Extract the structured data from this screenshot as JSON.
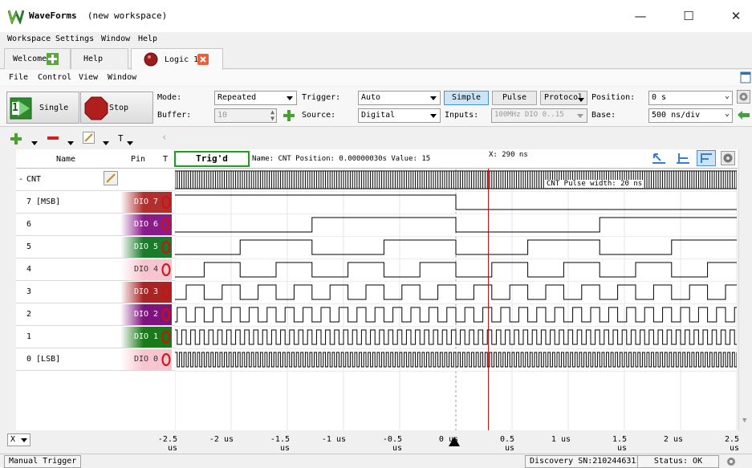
{
  "window": {
    "app_name": "WaveForms",
    "workspace": "(new workspace)",
    "controls": {
      "minimize": "—",
      "maximize": "☐",
      "close": "✕"
    }
  },
  "menubar": [
    "Workspace",
    "Settings",
    "Window",
    "Help"
  ],
  "tabs": [
    {
      "label": "Welcome"
    },
    {
      "label": "Help"
    },
    {
      "label": "Logic 1"
    }
  ],
  "submenu": [
    "File",
    "Control",
    "View",
    "Window"
  ],
  "toolbar": {
    "single_label": "Single",
    "single_badge": "1",
    "stop_label": "Stop",
    "mode_label": "Mode:",
    "mode_value": "Repeated",
    "buffer_label": "Buffer:",
    "buffer_value": "10",
    "trigger_label": "Trigger:",
    "trigger_value": "Auto",
    "source_label": "Source:",
    "source_value": "Digital",
    "simple_label": "Simple",
    "pulse_label": "Pulse",
    "protocol_label": "Protocol",
    "inputs_label": "Inputs:",
    "inputs_value": "100MHz DIO 0..15",
    "position_label": "Position:",
    "position_value": "0 s",
    "base_label": "Base:",
    "base_value": "500 ns/div"
  },
  "toolrow": {
    "t_label": "T"
  },
  "header": {
    "name": "Name",
    "pin": "Pin",
    "t": "T",
    "trig_status": "Trig'd",
    "info": "Name: CNT  Position: 0.00000030s  Value: 15",
    "cursor_x": "X: 290 ns",
    "pulse_width": "CNT Pulse width: 20 ns"
  },
  "bus": {
    "collapse": "-",
    "name": "CNT"
  },
  "signals": [
    {
      "name": "7 [MSB]",
      "pin": "DIO  7",
      "color": "#b03030",
      "fg": "#ffffff",
      "period_ns": 5120,
      "phase_ns": 2560
    },
    {
      "name": "6",
      "pin": "DIO  6",
      "color": "#8a1c8a",
      "fg": "#ffffff",
      "period_ns": 2560,
      "phase_ns": 1280
    },
    {
      "name": "5",
      "pin": "DIO  5",
      "color": "#1d7a2c",
      "fg": "#ffffff",
      "period_ns": 1280,
      "phase_ns": 640
    },
    {
      "name": "4",
      "pin": "DIO  4",
      "color": "#f7c4cf",
      "fg": "#333333",
      "period_ns": 640,
      "phase_ns": 320
    },
    {
      "name": "3",
      "pin": "DIO  3",
      "color": "#a82525",
      "fg": "#ffffff",
      "period_ns": 320,
      "phase_ns": 160
    },
    {
      "name": "2",
      "pin": "DIO  2",
      "color": "#7d137d",
      "fg": "#ffffff",
      "period_ns": 160,
      "phase_ns": 80
    },
    {
      "name": "1",
      "pin": "DIO  1",
      "color": "#1a7a1a",
      "fg": "#ffffff",
      "period_ns": 80,
      "phase_ns": 40
    },
    {
      "name": "0 [LSB]",
      "pin": "DIO  0",
      "color": "#f7c4cf",
      "fg": "#333333",
      "period_ns": 40,
      "phase_ns": 20
    }
  ],
  "xaxis": {
    "unit_label": "X",
    "ticks": [
      "-2.5 us",
      "-2 us",
      "-1.5 us",
      "-1 us",
      "-0.5 us",
      "0 us",
      "0.5 us",
      "1 us",
      "1.5 us",
      "2 us",
      "2.5 us"
    ],
    "range_us": [
      -2.5,
      2.5
    ],
    "cursor_us": 0.29
  },
  "status": {
    "manual_trigger": "Manual Trigger",
    "device": "Discovery SN:210244631198",
    "status": "Status: OK"
  },
  "colors": {
    "accent": "#4a90d9",
    "trig_border": "#1aa31a",
    "cursor": "#c00000",
    "wave": "#000000"
  }
}
